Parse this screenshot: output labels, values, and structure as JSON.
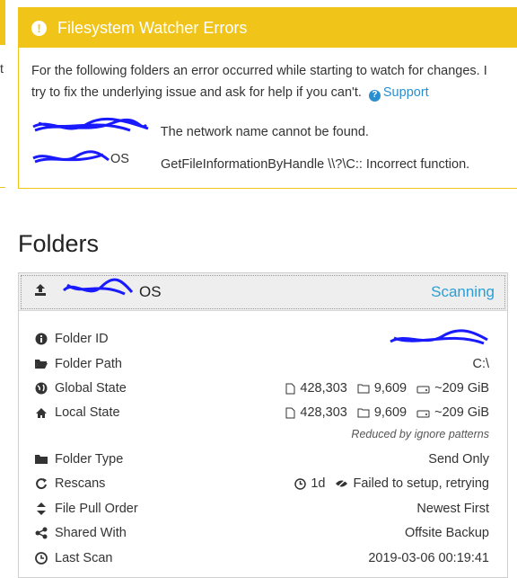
{
  "warning": {
    "title": "Filesystem Watcher Errors",
    "message_line1": "For the following folders an error occurred while starting to watch for changes. I",
    "message_line2": "try to fix the underlying issue and ask for help if you can't.",
    "support_label": "Support",
    "errors": [
      {
        "folder": "",
        "folder_suffix": "",
        "message": "The network name cannot be found."
      },
      {
        "folder": "",
        "folder_suffix": "OS",
        "message": "GetFileInformationByHandle \\\\?\\C:: Incorrect function."
      }
    ]
  },
  "folders_heading": "Folders",
  "folder": {
    "name_suffix": "OS",
    "status": "Scanning",
    "rows": {
      "folder_id": {
        "label": "Folder ID",
        "value": ""
      },
      "folder_path": {
        "label": "Folder Path",
        "value": "C:\\"
      },
      "global_state": {
        "label": "Global State",
        "files": "428,303",
        "dirs": "9,609",
        "size": "~209 GiB"
      },
      "local_state": {
        "label": "Local State",
        "files": "428,303",
        "dirs": "9,609",
        "size": "~209 GiB",
        "note": "Reduced by ignore patterns"
      },
      "folder_type": {
        "label": "Folder Type",
        "value": "Send Only"
      },
      "rescans": {
        "label": "Rescans",
        "interval": "1d",
        "watch_status": "Failed to setup, retrying"
      },
      "file_pull_order": {
        "label": "File Pull Order",
        "value": "Newest First"
      },
      "shared_with": {
        "label": "Shared With",
        "value": "Offsite Backup"
      },
      "last_scan": {
        "label": "Last Scan",
        "value": "2019-03-06 00:19:41"
      }
    }
  },
  "colors": {
    "warning": "#f0c419",
    "link": "#2a8fcf",
    "scanning": "#2a9fd6",
    "redaction": "#1a1aff"
  },
  "left_fragment": "t"
}
